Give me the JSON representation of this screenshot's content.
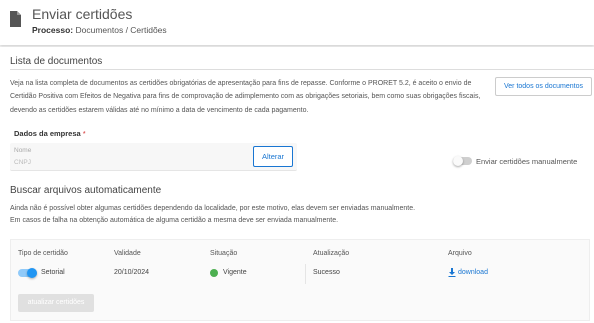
{
  "header": {
    "title": "Enviar certidões",
    "process_label": "Processo:",
    "process_path": "Documentos / Certidões"
  },
  "lista": {
    "heading": "Lista de documentos",
    "description": "Veja na lista completa de documentos as certidões obrigatórias de apresentação para fins de repasse. Conforme o PRORET 5.2, é aceito o envio de Certidão Positiva com Efeitos de Negativa para fins de comprovação de adimplemento com as obrigações setoriais, bem como suas obrigações fiscais, devendo as certidões estarem válidas até no mínimo a data de vencimento de cada pagamento.",
    "ver_todos_label": "Ver todos os documentos"
  },
  "empresa": {
    "label": "Dados da empresa",
    "required_mark": "*",
    "field_label": "Nome",
    "field_placeholder": "CNPJ",
    "alterar_label": "Alterar",
    "manual_toggle_label": "Enviar certidões manualmente",
    "manual_toggle_on": false
  },
  "buscar": {
    "heading": "Buscar arquivos automaticamente",
    "line1": "Ainda não é possível obter algumas certidões dependendo da localidade, por este motivo, elas devem ser enviadas manualmente.",
    "line2": "Em casos de falha na obtenção automática de alguma certidão a mesma deve ser enviada manualmente."
  },
  "table": {
    "columns": [
      "Tipo de certidão",
      "Validade",
      "Situação",
      "Atualização",
      "Arquivo"
    ],
    "rows": [
      {
        "tipo": "Setorial",
        "tipo_toggle_on": true,
        "validade": "20/10/2024",
        "situacao": "Vigente",
        "situacao_color": "#4caf50",
        "atualizacao": "Sucesso",
        "arquivo": "download"
      }
    ],
    "atualizar_label": "atualizar certidões"
  },
  "colors": {
    "accent": "#1976d2",
    "success": "#4caf50",
    "required": "#d32f2f"
  },
  "icons": {
    "header": "document-icon",
    "download": "download-icon"
  }
}
